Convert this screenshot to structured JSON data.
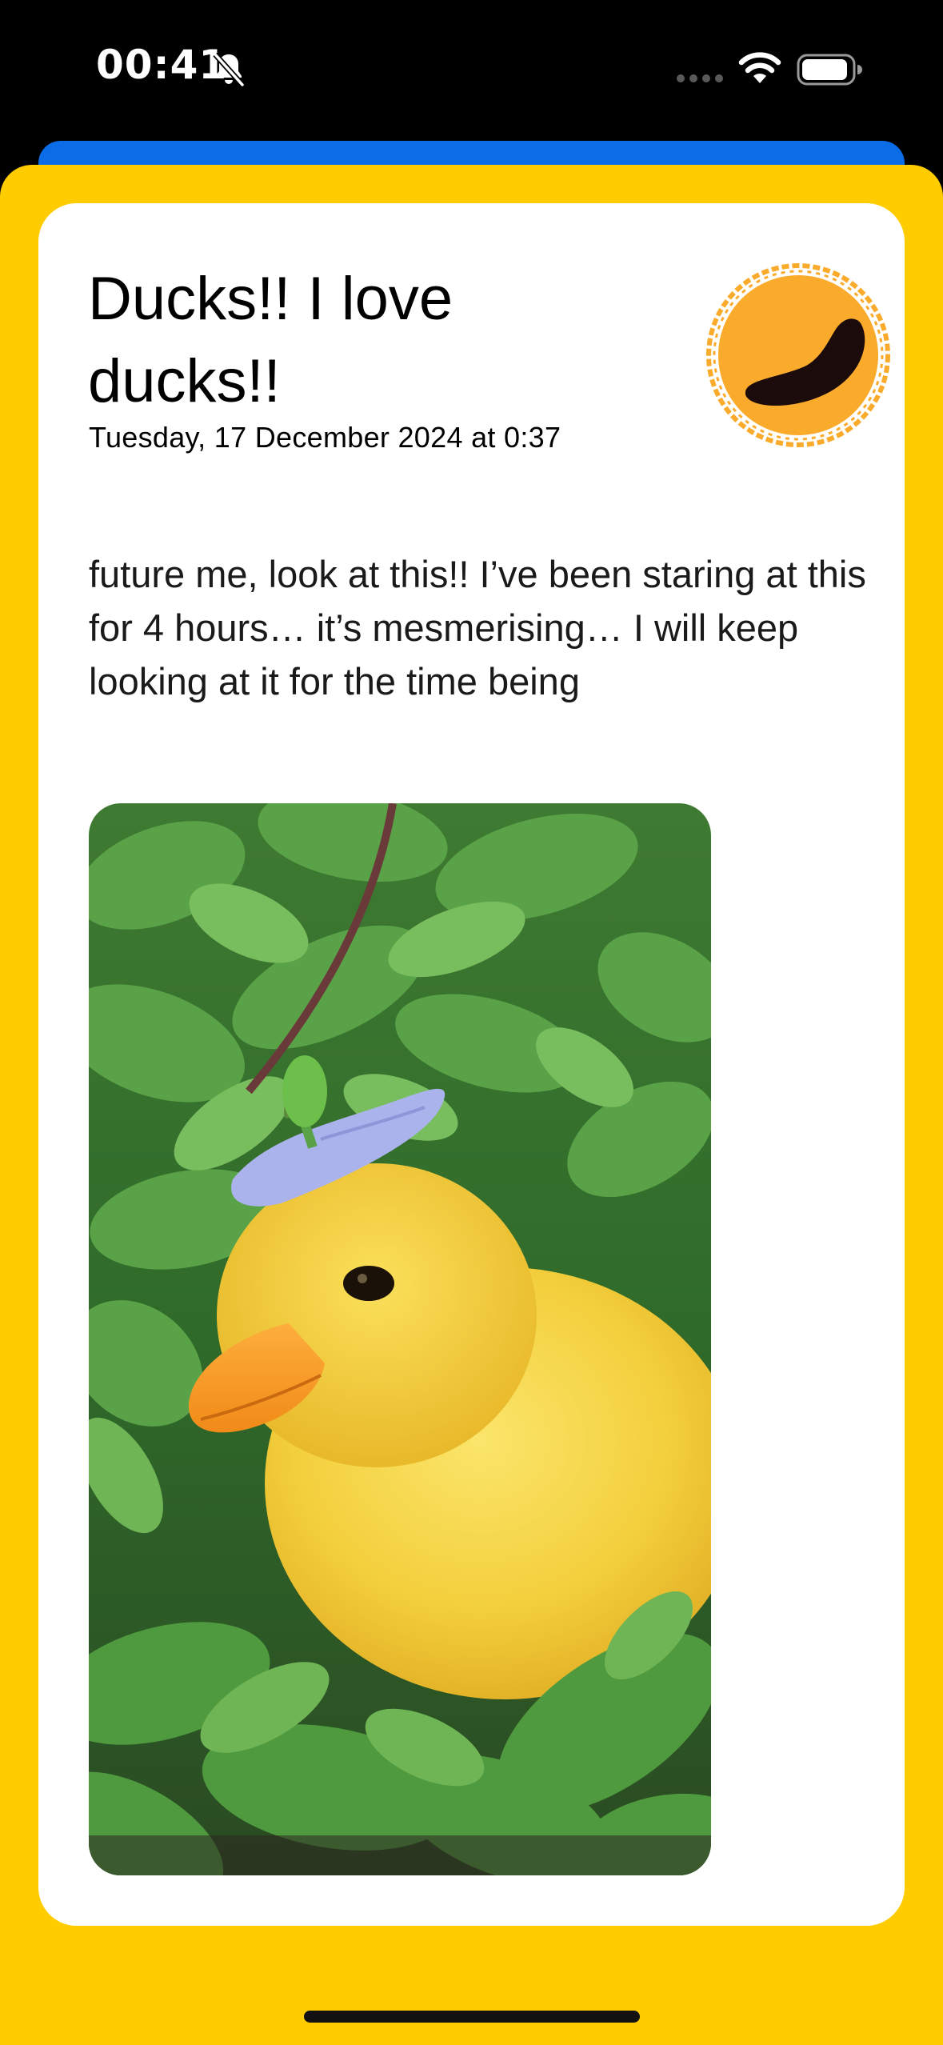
{
  "status_bar": {
    "time": "00:41",
    "silent_icon": "bell-slash-icon",
    "signal_icon": "cellular-dots-icon",
    "wifi_icon": "wifi-icon",
    "battery_icon": "battery-icon"
  },
  "entry": {
    "title": "Ducks!! I love ducks!!",
    "date": "Tuesday, 17 December 2024 at 0:37",
    "body": "future me, look at this!! I’ve been staring at this for 4 hours… it’s mesmerising… I will keep looking at it for the time being",
    "mood_icon": "mood-sun-icon",
    "photo_subject": "duckling-photo"
  },
  "colors": {
    "sheet_background": "#ffcc00",
    "back_sheet": "#0a6ce6",
    "card_background": "#ffffff",
    "mood_orange": "#fbab2c",
    "mood_dark": "#1b0b0b"
  }
}
